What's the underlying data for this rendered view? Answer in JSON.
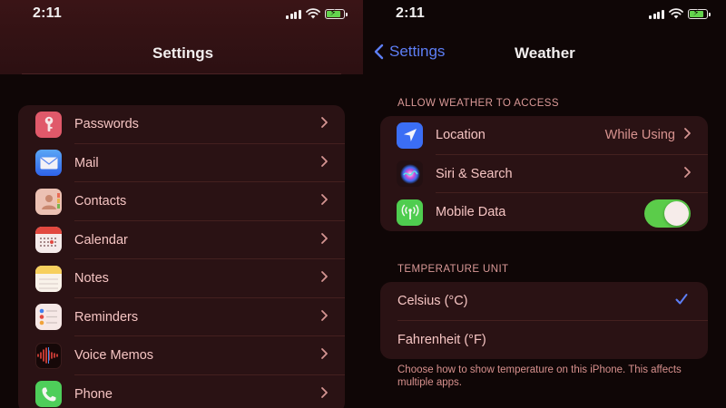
{
  "left": {
    "status_time": "2:11",
    "title": "Settings",
    "items": [
      {
        "label": "Passwords",
        "icon": "key-icon",
        "color": "#e0596a"
      },
      {
        "label": "Mail",
        "icon": "mail-icon",
        "color": "#3c7bf1"
      },
      {
        "label": "Contacts",
        "icon": "contacts-icon",
        "color": "#e9b9a9"
      },
      {
        "label": "Calendar",
        "icon": "calendar-icon",
        "color": "#f4e9e7"
      },
      {
        "label": "Notes",
        "icon": "notes-icon",
        "color": "#f6d873"
      },
      {
        "label": "Reminders",
        "icon": "reminders-icon",
        "color": "#f5e7e6"
      },
      {
        "label": "Voice Memos",
        "icon": "voice-memos-icon",
        "color": "#160808"
      },
      {
        "label": "Phone",
        "icon": "phone-icon",
        "color": "#4ece5a"
      }
    ]
  },
  "right": {
    "status_time": "2:11",
    "back_label": "Settings",
    "title": "Weather",
    "access_header": "ALLOW WEATHER TO ACCESS",
    "access_items": [
      {
        "label": "Location",
        "value": "While Using",
        "icon": "location-arrow-icon",
        "color": "#3b6ef5"
      },
      {
        "label": "Siri & Search",
        "value": "",
        "icon": "siri-icon",
        "color": "#231012"
      },
      {
        "label": "Mobile Data",
        "value": "",
        "icon": "antenna-icon",
        "color": "#4fcd4f",
        "toggle": true
      }
    ],
    "unit_header": "TEMPERATURE UNIT",
    "unit_options": [
      {
        "label": "Celsius (°C)",
        "selected": true
      },
      {
        "label": "Fahrenheit (°F)",
        "selected": false
      }
    ],
    "footnote": "Choose how to show temperature on this iPhone. This affects multiple apps."
  },
  "colors": {
    "accent_blue": "#5d7ef5",
    "toggle_on": "#5bcc4a",
    "row_text": "#f5c4c2",
    "cell_bg": "#2a1214"
  }
}
